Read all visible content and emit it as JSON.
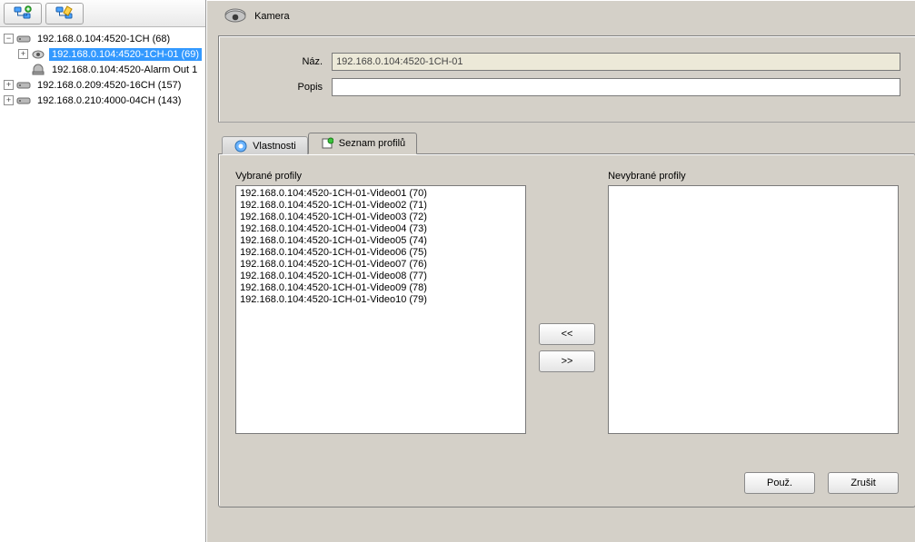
{
  "header": {
    "title": "Kamera"
  },
  "form": {
    "name_label": "Náz.",
    "name_value": "192.168.0.104:4520-1CH-01",
    "desc_label": "Popis",
    "desc_value": ""
  },
  "tabs": {
    "properties": "Vlastnosti",
    "profiles": "Seznam profilů"
  },
  "dual": {
    "selected_label": "Vybrané profily",
    "unselected_label": "Nevybrané profily",
    "move_left": "<<",
    "move_right": ">>"
  },
  "buttons": {
    "apply": "Použ.",
    "cancel": "Zrušit"
  },
  "tree": {
    "n0": "192.168.0.104:4520-1CH (68)",
    "n0_0": "192.168.0.104:4520-1CH-01 (69)",
    "n0_1": "192.168.0.104:4520-Alarm Out 1",
    "n1": "192.168.0.209:4520-16CH (157)",
    "n2": "192.168.0.210:4000-04CH (143)"
  },
  "profiles_selected": [
    "192.168.0.104:4520-1CH-01-Video01 (70)",
    "192.168.0.104:4520-1CH-01-Video02 (71)",
    "192.168.0.104:4520-1CH-01-Video03 (72)",
    "192.168.0.104:4520-1CH-01-Video04 (73)",
    "192.168.0.104:4520-1CH-01-Video05 (74)",
    "192.168.0.104:4520-1CH-01-Video06 (75)",
    "192.168.0.104:4520-1CH-01-Video07 (76)",
    "192.168.0.104:4520-1CH-01-Video08 (77)",
    "192.168.0.104:4520-1CH-01-Video09 (78)",
    "192.168.0.104:4520-1CH-01-Video10 (79)"
  ],
  "profiles_unselected": []
}
